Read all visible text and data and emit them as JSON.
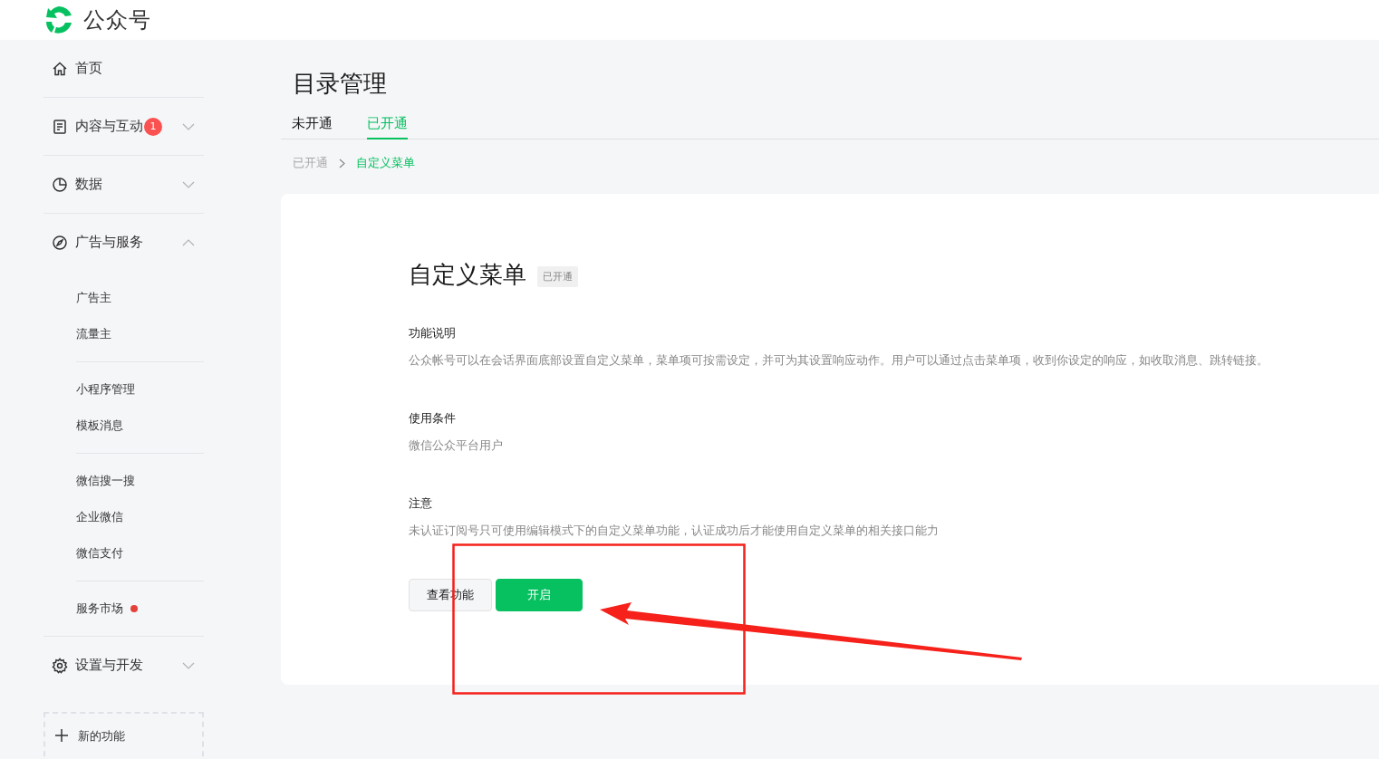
{
  "header": {
    "brand": "公众号"
  },
  "sidebar": {
    "items": [
      {
        "label": "首页"
      },
      {
        "label": "内容与互动",
        "badge": "1",
        "expanded": false
      },
      {
        "label": "数据",
        "expanded": false
      },
      {
        "label": "广告与服务",
        "expanded": true,
        "children": [
          {
            "items": [
              {
                "label": "广告主"
              },
              {
                "label": "流量主"
              }
            ]
          },
          {
            "items": [
              {
                "label": "小程序管理"
              },
              {
                "label": "模板消息"
              }
            ]
          },
          {
            "items": [
              {
                "label": "微信搜一搜"
              },
              {
                "label": "企业微信"
              },
              {
                "label": "微信支付"
              }
            ]
          },
          {
            "items": [
              {
                "label": "服务市场",
                "color": "#e5403a"
              }
            ]
          }
        ]
      },
      {
        "label": "设置与开发",
        "expanded": false
      }
    ],
    "new_feature": "新的功能"
  },
  "page": {
    "title": "目录管理",
    "tabs": [
      {
        "label": "未开通",
        "selected": false
      },
      {
        "label": "已开通",
        "selected": true
      }
    ],
    "breadcrumb": [
      "已开通",
      "自定义菜单"
    ],
    "card": {
      "title": "自定义菜单",
      "status": "已开通",
      "sections": [
        {
          "heading": "功能说明",
          "text": "公众帐号可以在会话界面底部设置自定义菜单，菜单项可按需设定，并可为其设置响应动作。用户可以通过点击菜单项，收到你设定的响应，如收取消息、跳转链接。"
        },
        {
          "heading": "使用条件",
          "text": "微信公众平台用户"
        },
        {
          "heading": "注意",
          "text": "未认证订阅号只可使用编辑模式下的自定义菜单功能，认证成功后才能使用自定义菜单的相关接口能力"
        }
      ],
      "buttons": [
        {
          "label": "查看功能",
          "kind": "secondary"
        },
        {
          "label": "开启",
          "kind": "primary"
        }
      ]
    }
  }
}
